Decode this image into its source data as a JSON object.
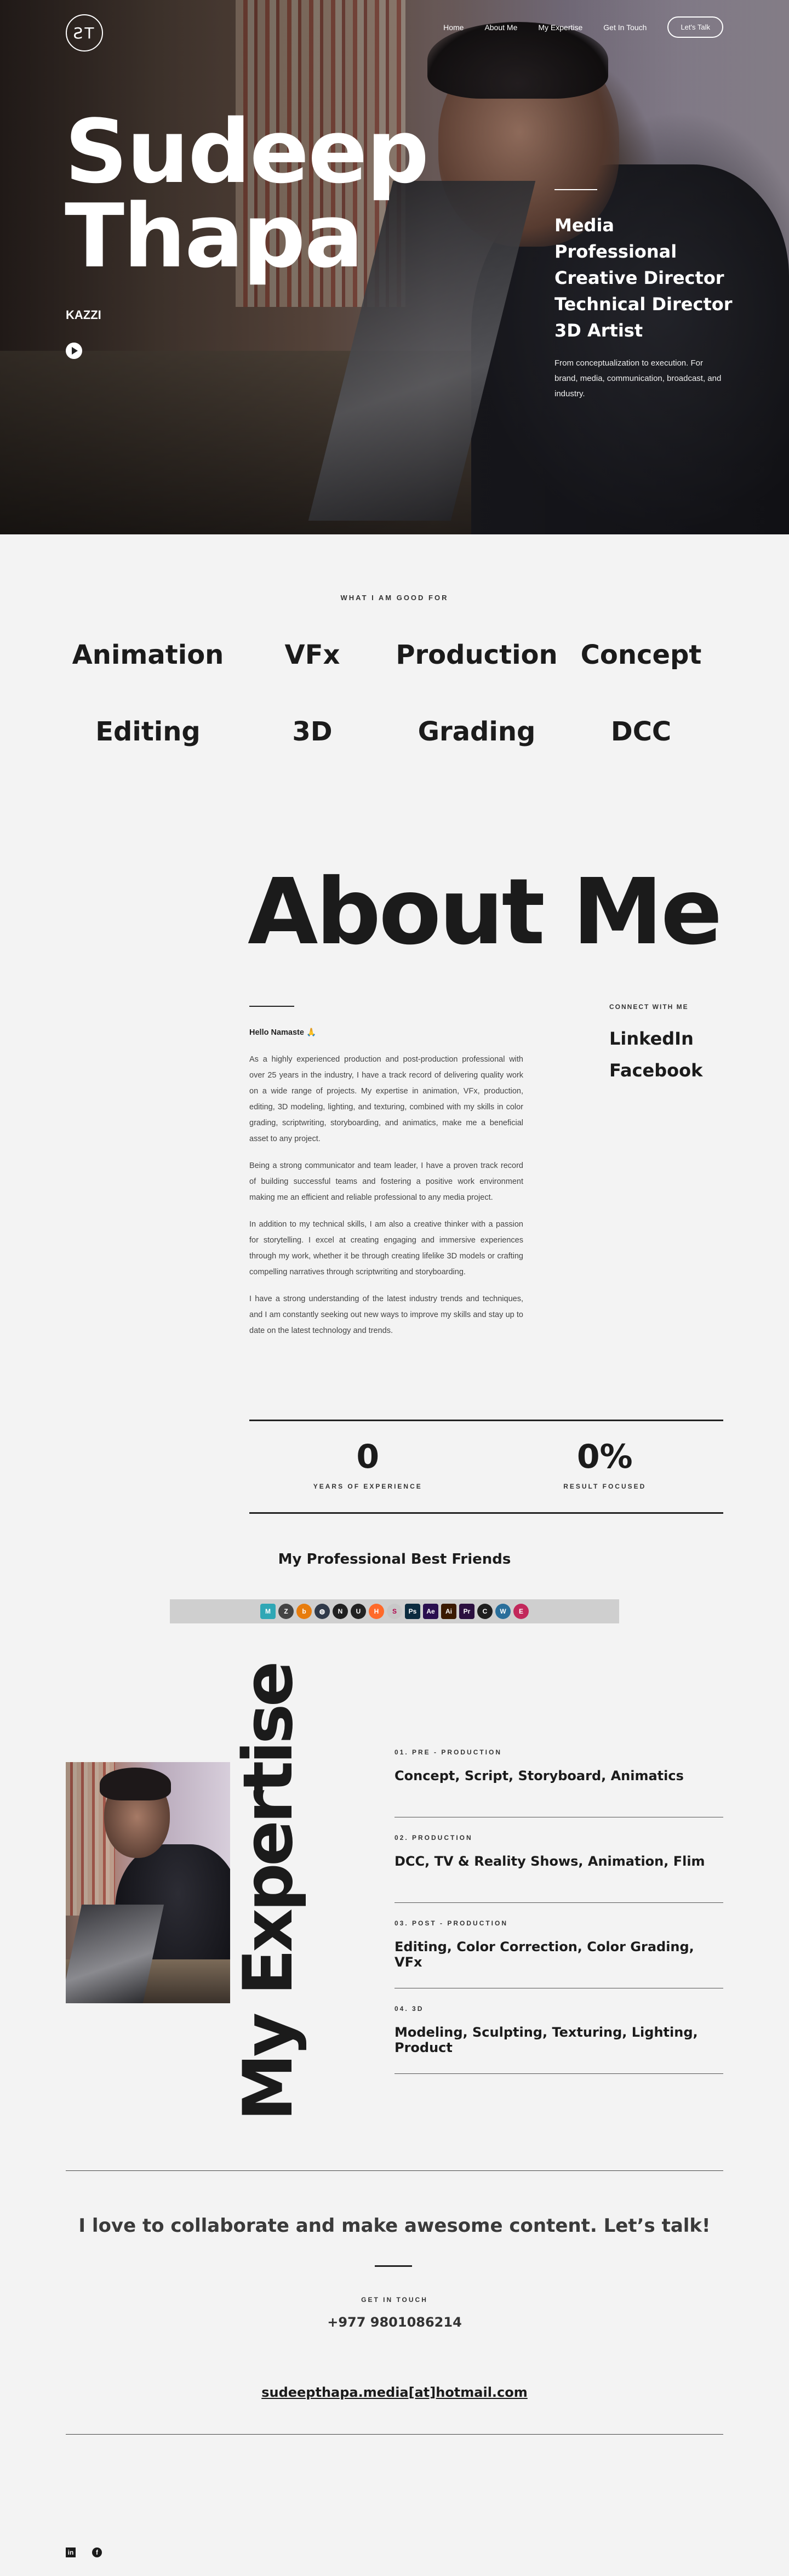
{
  "nav": {
    "logo": "ƧT",
    "links": [
      "Home",
      "About Me",
      "My Expertise",
      "Get In Touch"
    ],
    "cta": "Let's Talk"
  },
  "hero": {
    "first_name": "Sudeep",
    "last_name": "Thapa",
    "alias": "KAZZI",
    "roles": [
      "Media",
      "Professional",
      "Creative Director",
      "Technical Director",
      "3D Artist"
    ],
    "description": "From conceptualization to execution. For brand, media, communication, broadcast, and industry."
  },
  "good_for": {
    "heading": "WHAT I AM GOOD FOR",
    "skills": [
      "Animation",
      "VFx",
      "Production",
      "Concept",
      "Editing",
      "3D",
      "Grading",
      "DCC"
    ]
  },
  "about": {
    "title": "About Me",
    "greeting": "Hello Namaste 🙏",
    "paragraphs": [
      "As a highly experienced production and post-production professional with over 25 years in the industry, I have a track record of delivering quality work on a wide range of projects. My expertise in animation, VFx, production, editing, 3D modeling, lighting, and texturing, combined with my skills in color grading, scriptwriting, storyboarding, and animatics, make me a beneficial asset to any project.",
      "Being a strong communicator and team leader, I have a proven track record of building successful teams and fostering a positive work environment making me an efficient and reliable professional to any media project.",
      "In addition to my technical skills, I am also a creative thinker with a passion for storytelling. I excel at creating engaging and immersive experiences through my work, whether it be through creating lifelike 3D models or crafting compelling narratives through scriptwriting and storyboarding.",
      "I have a strong understanding of the latest industry trends and techniques, and I am constantly seeking out new ways to improve my skills and stay up to date on the latest technology and trends."
    ],
    "connect_heading": "CONNECT WITH ME",
    "connect_links": [
      "LinkedIn",
      "Facebook"
    ],
    "stats": [
      {
        "value": "0",
        "label": "YEARS OF EXPERIENCE"
      },
      {
        "value": "0%",
        "label": "RESULT FOCUSED"
      }
    ],
    "friends_heading": "My Professional Best Friends",
    "tools": [
      {
        "icon": "maya-icon",
        "glyph": "M",
        "color": "#2fa7b5"
      },
      {
        "icon": "zbrush-icon",
        "glyph": "Z",
        "color": "#444444"
      },
      {
        "icon": "blender-icon",
        "glyph": "b",
        "color": "#e87d0d"
      },
      {
        "icon": "davinci-resolve-icon",
        "glyph": "◍",
        "color": "#303a4a"
      },
      {
        "icon": "nuke-icon",
        "glyph": "N",
        "color": "#202020"
      },
      {
        "icon": "unreal-icon",
        "glyph": "U",
        "color": "#222222"
      },
      {
        "icon": "houdini-icon",
        "glyph": "H",
        "color": "#ff6a2a"
      },
      {
        "icon": "substance-icon",
        "glyph": "S",
        "color": "#c8c8c8"
      },
      {
        "icon": "photoshop-icon",
        "glyph": "Ps",
        "color": "#0b2b3f"
      },
      {
        "icon": "after-effects-icon",
        "glyph": "Ae",
        "color": "#2a0f4f"
      },
      {
        "icon": "illustrator-icon",
        "glyph": "Ai",
        "color": "#3b1a00"
      },
      {
        "icon": "premiere-icon",
        "glyph": "Pr",
        "color": "#2b0f3f"
      },
      {
        "icon": "cinema4d-icon",
        "glyph": "C",
        "color": "#1f1f1f"
      },
      {
        "icon": "wordpress-icon",
        "glyph": "W",
        "color": "#2a6f9b"
      },
      {
        "icon": "elementor-icon",
        "glyph": "E",
        "color": "#c2285b"
      }
    ]
  },
  "expertise": {
    "title": "My Expertise",
    "items": [
      {
        "tag": "01. PRE - PRODUCTION",
        "text": "Concept, Script, Storyboard, Animatics"
      },
      {
        "tag": "02. PRODUCTION",
        "text": "DCC, TV & Reality Shows, Animation, Flim"
      },
      {
        "tag": "03. POST - PRODUCTION",
        "text": "Editing, Color Correction, Color Grading, VFx"
      },
      {
        "tag": "04. 3D",
        "text": "Modeling, Sculpting, Texturing, Lighting, Product"
      }
    ]
  },
  "contact": {
    "headline": "I love to collaborate and make awesome content. Let’s talk!",
    "label": "GET IN TOUCH",
    "phone": "+977 9801086214",
    "email": "sudeepthapa.media[at]hotmail.com"
  },
  "footer": {
    "social": [
      {
        "icon": "linkedin-icon",
        "glyph": "in"
      },
      {
        "icon": "facebook-icon",
        "glyph": "f"
      }
    ]
  }
}
